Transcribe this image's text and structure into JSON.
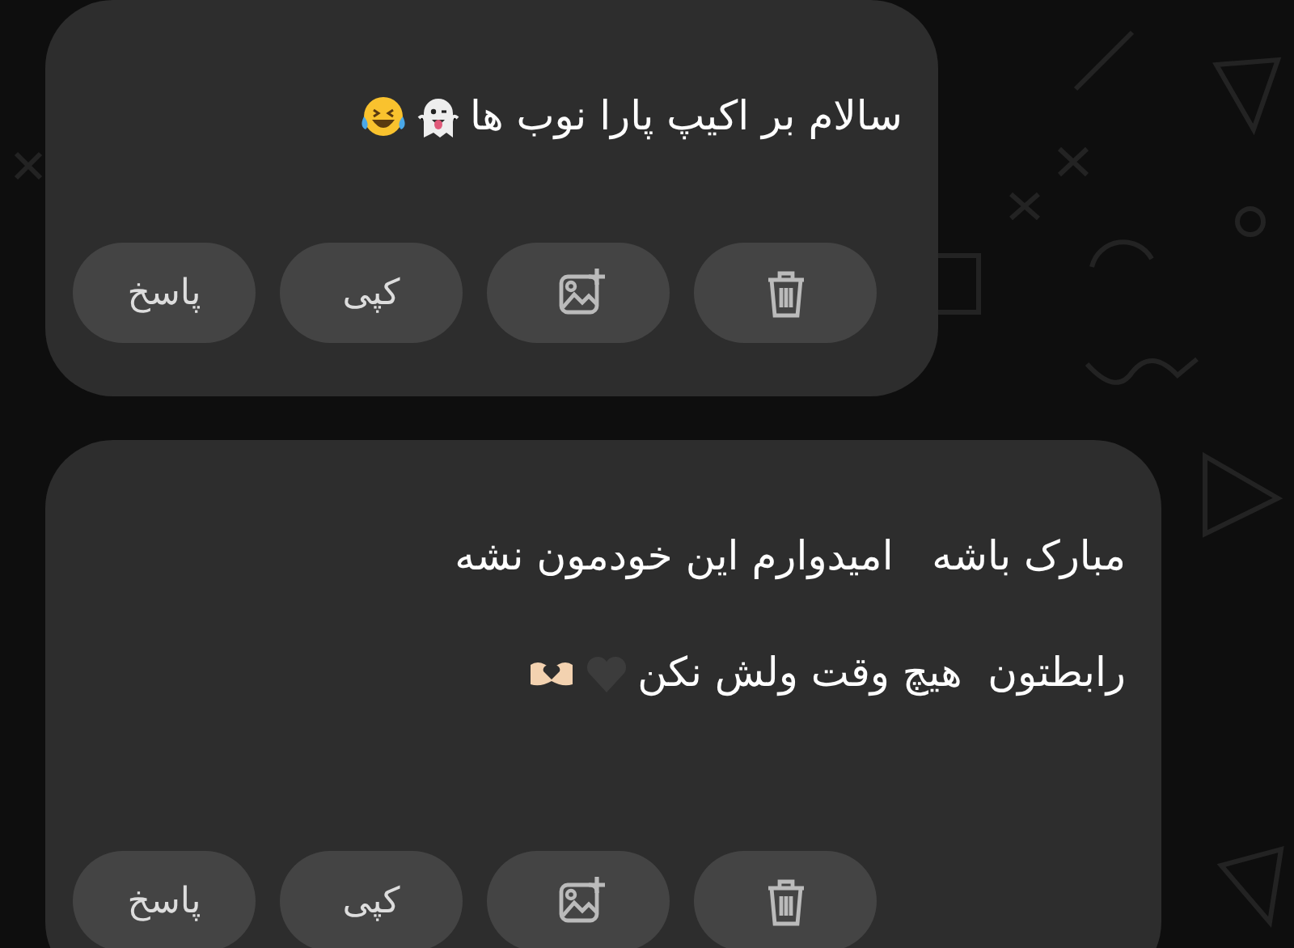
{
  "messages": [
    {
      "lines": [
        {
          "text": "سالام بر اکیپ پارا نوب ها",
          "icons": [
            {
              "kind": "ghost"
            },
            {
              "kind": "laughing"
            }
          ]
        }
      ],
      "actions": [
        {
          "kind": "delete"
        },
        {
          "kind": "add-image"
        },
        {
          "kind": "copy",
          "label": "کپی"
        },
        {
          "kind": "reply",
          "label": "پاسخ"
        }
      ]
    },
    {
      "lines": [
        {
          "text": "مبارک باشه   امیدوارم این خودمون نشه"
        },
        {
          "text": "رابطتون  هیچ وقت ولش نکن",
          "icons": [
            {
              "kind": "heart"
            },
            {
              "kind": "heart-hands"
            }
          ]
        }
      ],
      "actions": [
        {
          "kind": "delete"
        },
        {
          "kind": "add-image"
        },
        {
          "kind": "copy",
          "label": "کپی"
        },
        {
          "kind": "reply",
          "label": "پاسخ"
        }
      ]
    }
  ]
}
